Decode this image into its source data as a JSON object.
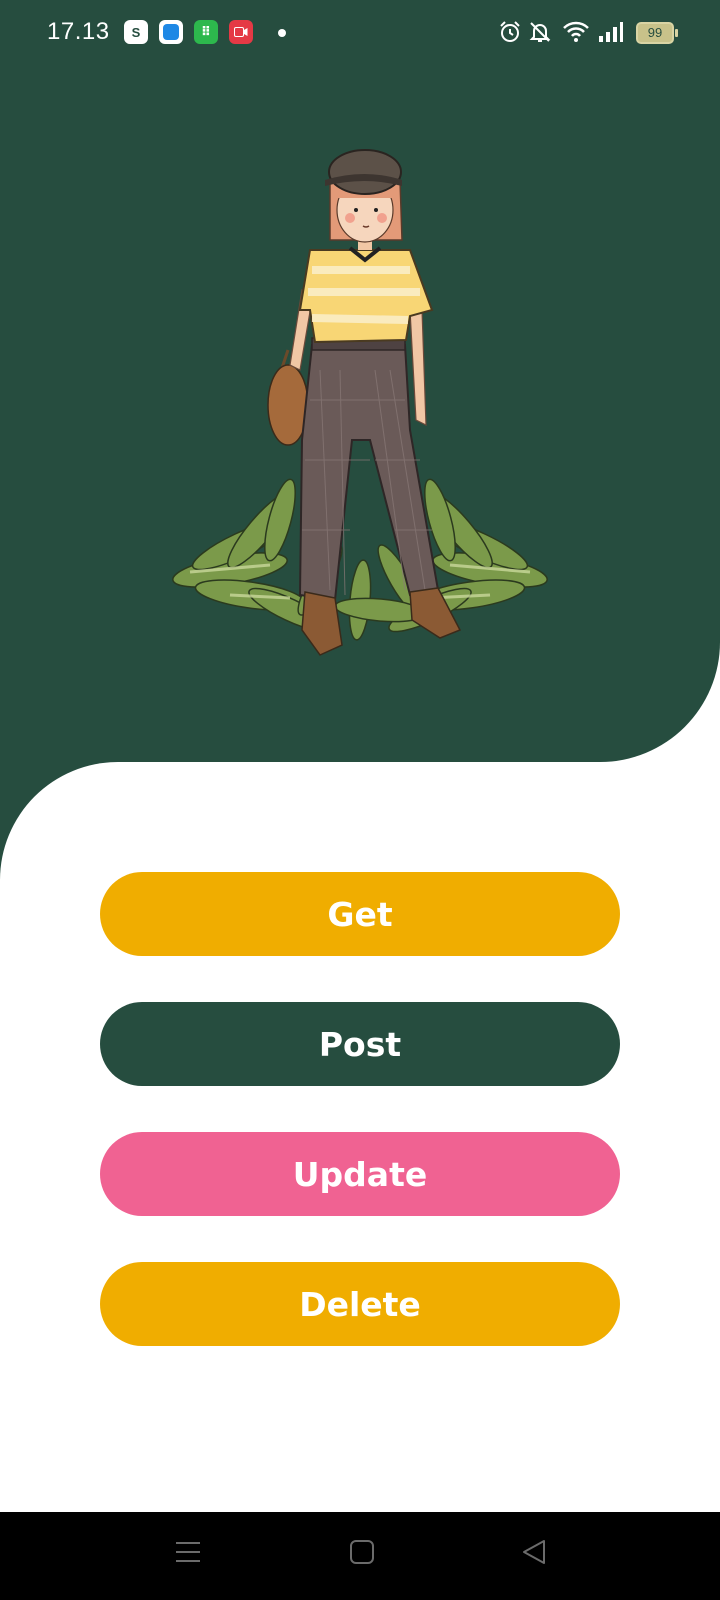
{
  "status_bar": {
    "time": "17.13",
    "battery": "99",
    "notification_icons": [
      "shopee-icon",
      "blue-app-icon",
      "green-store-icon",
      "screen-recorder-icon"
    ],
    "system_icons": [
      "alarm-icon",
      "bell-off-icon",
      "wifi-icon",
      "signal-icon",
      "battery-icon"
    ]
  },
  "hero": {
    "illustration": "girl-with-plants-illustration",
    "background_color": "#264d3f"
  },
  "actions": {
    "get_label": "Get",
    "post_label": "Post",
    "update_label": "Update",
    "delete_label": "Delete"
  },
  "colors": {
    "primary_green": "#264d3f",
    "amber": "#f0ad00",
    "pink": "#f06292"
  },
  "nav_bar": {
    "buttons": [
      "menu-icon",
      "home-square-icon",
      "back-triangle-icon"
    ]
  }
}
